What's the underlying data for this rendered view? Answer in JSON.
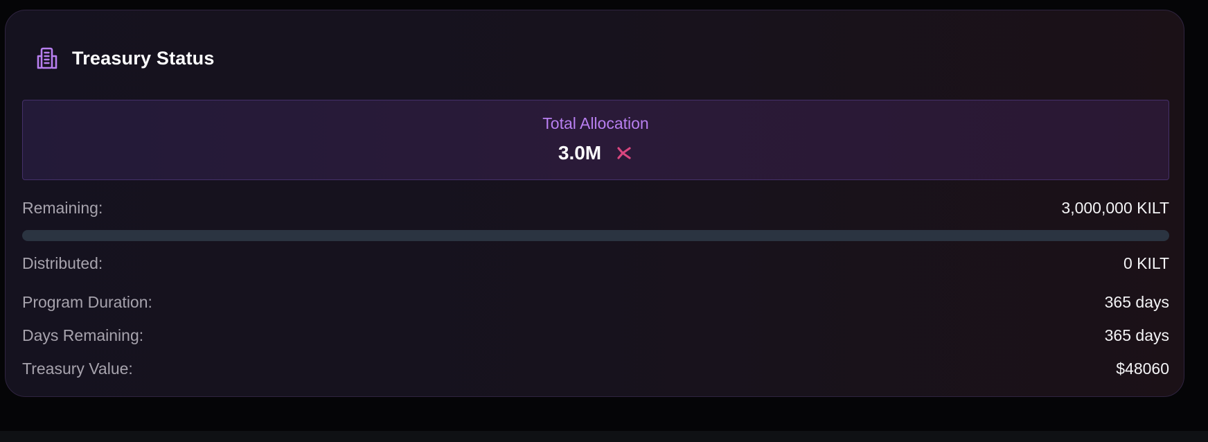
{
  "header": {
    "title": "Treasury Status",
    "icon": "building-icon"
  },
  "allocation": {
    "label": "Total Allocation",
    "value": "3.0M",
    "token_icon": "kilt-logo-icon"
  },
  "stats": {
    "remaining_label": "Remaining:",
    "remaining_value": "3,000,000 KILT",
    "distributed_progress": 0,
    "distributed_label": "Distributed:",
    "distributed_value": "0 KILT",
    "duration_label": "Program Duration:",
    "duration_value": "365 days",
    "days_remaining_label": "Days Remaining:",
    "days_remaining_value": "365 days",
    "treasury_value_label": "Treasury Value:",
    "treasury_value_value": "$48060"
  },
  "colors": {
    "accent": "#b87ff0",
    "token": "#d9467f",
    "progress_track": "#2b3441"
  }
}
